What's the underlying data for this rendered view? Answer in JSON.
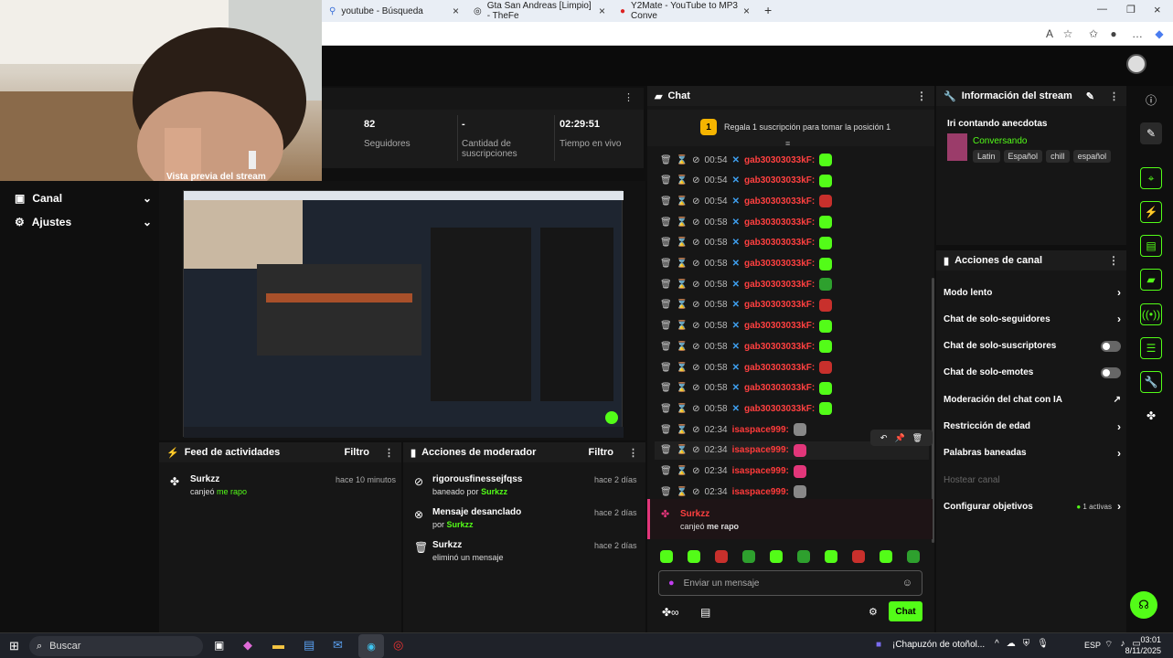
{
  "browser": {
    "tabs": [
      {
        "label": "youtube - Búsqueda"
      },
      {
        "label": "Gta San Andreas [Limpio] - TheFe"
      },
      {
        "label": "Y2Mate - YouTube to MP3 Conve"
      }
    ]
  },
  "sidebar": {
    "items": [
      {
        "label": "Canal",
        "icon": "tv-icon"
      },
      {
        "label": "Ajustes",
        "icon": "gear-icon"
      }
    ]
  },
  "stats": [
    {
      "value": "82",
      "label": "Seguidores"
    },
    {
      "value": "-",
      "label": "Cantidad de suscripciones"
    },
    {
      "value": "02:29:51",
      "label": "Tiempo en vivo"
    }
  ],
  "preview": {
    "title": "Vista previa del stream"
  },
  "activity_feed": {
    "title": "Feed de actividades",
    "filter": "Filtro",
    "items": [
      {
        "user": "Surkzz",
        "time": "hace 10 minutos",
        "action": "canjeó",
        "reward": "me rapo"
      }
    ]
  },
  "mod_actions": {
    "title": "Acciones de moderador",
    "filter": "Filtro",
    "items": [
      {
        "user": "rigorousfinessejfqss",
        "time": "hace 2 días",
        "line1": "baneado por",
        "by": "Surkzz"
      },
      {
        "user": "Mensaje desanclado",
        "time": "hace 2 días",
        "line1": "por",
        "by": "Surkzz"
      },
      {
        "user": "Surkzz",
        "time": "hace 2 días",
        "line1": "eliminó un mensaje",
        "by": ""
      }
    ]
  },
  "chat": {
    "title": "Chat",
    "pinned_goal": "Regala 1 suscripción para tomar la posición 1",
    "goal_rank": "1",
    "messages": [
      {
        "time": "00:54",
        "user": "gab30303033kF:",
        "color": "#53fc18"
      },
      {
        "time": "00:54",
        "user": "gab30303033kF:",
        "color": "#53fc18"
      },
      {
        "time": "00:54",
        "user": "gab30303033kF:",
        "color": "#c8302c"
      },
      {
        "time": "00:58",
        "user": "gab30303033kF:",
        "color": "#53fc18"
      },
      {
        "time": "00:58",
        "user": "gab30303033kF:",
        "color": "#53fc18"
      },
      {
        "time": "00:58",
        "user": "gab30303033kF:",
        "color": "#53fc18"
      },
      {
        "time": "00:58",
        "user": "gab30303033kF:",
        "color": "#2ea02e"
      },
      {
        "time": "00:58",
        "user": "gab30303033kF:",
        "color": "#c8302c"
      },
      {
        "time": "00:58",
        "user": "gab30303033kF:",
        "color": "#53fc18"
      },
      {
        "time": "00:58",
        "user": "gab30303033kF:",
        "color": "#53fc18"
      },
      {
        "time": "00:58",
        "user": "gab30303033kF:",
        "color": "#c8302c"
      },
      {
        "time": "00:58",
        "user": "gab30303033kF:",
        "color": "#53fc18"
      },
      {
        "time": "00:58",
        "user": "gab30303033kF:",
        "color": "#53fc18"
      },
      {
        "time": "02:34",
        "user": "isaspace999:",
        "color": "#888888"
      },
      {
        "time": "02:34",
        "user": "isaspace999:",
        "color": "#e2367a"
      },
      {
        "time": "02:34",
        "user": "isaspace999:",
        "color": "#e2367a"
      },
      {
        "time": "02:34",
        "user": "isaspace999:",
        "color": "#888888"
      }
    ],
    "redeem": {
      "user": "Surkzz",
      "action": "canjeó",
      "reward": "me rapo"
    },
    "input_placeholder": "Enviar un mensaje",
    "send_label": "Chat"
  },
  "stream_info": {
    "title": "Información del stream",
    "stream_title": "Iri contando anecdotas",
    "category": "Conversando",
    "tags": [
      "Latin",
      "Español",
      "chill",
      "español"
    ]
  },
  "channel_actions": {
    "title": "Acciones de canal",
    "items": [
      {
        "label": "Modo lento",
        "control": "chevron"
      },
      {
        "label": "Chat de solo-seguidores",
        "control": "chevron"
      },
      {
        "label": "Chat de solo-suscriptores",
        "control": "toggle"
      },
      {
        "label": "Chat de solo-emotes",
        "control": "toggle"
      },
      {
        "label": "Moderación del chat con IA",
        "control": "external"
      },
      {
        "label": "Restricción de edad",
        "control": "chevron"
      },
      {
        "label": "Palabras baneadas",
        "control": "chevron"
      },
      {
        "label": "Hostear canal",
        "control": "none"
      },
      {
        "label": "Configurar objetivos",
        "control": "chevron"
      }
    ],
    "goals_active": "1 activas"
  },
  "taskbar": {
    "search": "Buscar",
    "news": "¡Chapuzón de otoñol...",
    "lang": "ESP",
    "time": "03:01",
    "date": "8/11/2025"
  }
}
